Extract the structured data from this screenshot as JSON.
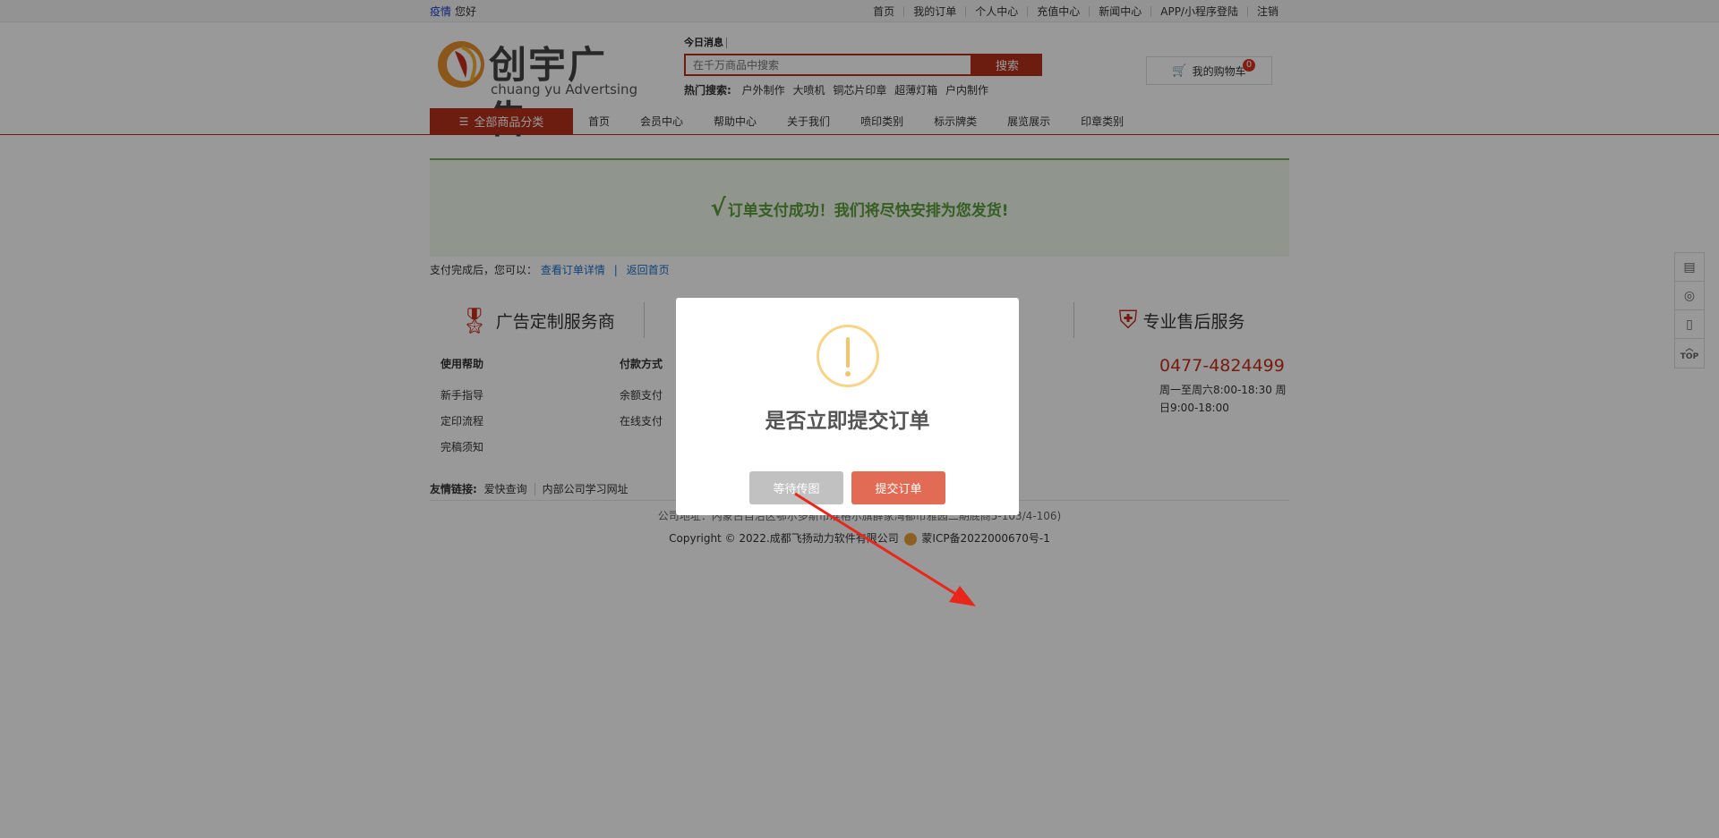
{
  "topbar": {
    "epidemic_link": "疫情",
    "greeting": "您好",
    "nav": [
      "首页",
      "我的订单",
      "个人中心",
      "充值中心",
      "新闻中心",
      "APP/小程序登陆",
      "注销"
    ]
  },
  "header": {
    "logo_cn": "创宇广告",
    "logo_en": "chuang yu Advertsing",
    "today_news": "今日消息",
    "search_placeholder": "在千万商品中搜索",
    "search_button": "搜索",
    "hot_label": "热门搜索:",
    "hot_keywords": [
      "户外制作",
      "大喷机",
      "铜芯片印章",
      "超薄灯箱",
      "户内制作"
    ],
    "cart_label": "我的购物车",
    "cart_count": "0"
  },
  "nav": {
    "all_categories": "全部商品分类",
    "items": [
      "首页",
      "会员中心",
      "帮助中心",
      "关于我们",
      "喷印类别",
      "标示牌类",
      "展览展示",
      "印章类别"
    ]
  },
  "success": {
    "check": "√",
    "message": "订单支付成功！我们将尽快安排为您发货!"
  },
  "after": {
    "prefix": "支付完成后，您可以：",
    "view_order": "查看订单详情",
    "sep": "|",
    "back_home": "返回首页"
  },
  "services": [
    "广告定制服务商",
    "",
    "",
    "专业售后服务"
  ],
  "footer": {
    "cols": [
      {
        "title": "使用帮助",
        "links": [
          "新手指导",
          "定印流程",
          "完稿须知"
        ]
      },
      {
        "title": "付款方式",
        "links": [
          "余额支付",
          "在线支付"
        ]
      }
    ],
    "phone": "0477-4824499",
    "hours": "周一至周六8:00-18:30 周日9:00-18:00",
    "links_label": "友情链接:",
    "links": [
      "爱快查询",
      "内部公司学习网址"
    ],
    "address": "公司地址：内蒙古自治区鄂尔多斯市准格尔旗薛家湾都市雅园二期底商5-103/4-106)",
    "copyright_prefix": "Copyright © 2022.成都飞扬动力软件有限公司",
    "icp": "蒙ICP备2022000670号-1"
  },
  "side_tools": {
    "top_label": "TOP"
  },
  "modal": {
    "title": "是否立即提交订单",
    "wait_button": "等待传图",
    "submit_button": "提交订单"
  },
  "colors": {
    "brand_red": "#b6301c",
    "success_green": "#5a9d39",
    "warn_yellow": "#f5c36b",
    "submit_red": "#e16b54",
    "annotation_arrow": "#e8271a"
  }
}
